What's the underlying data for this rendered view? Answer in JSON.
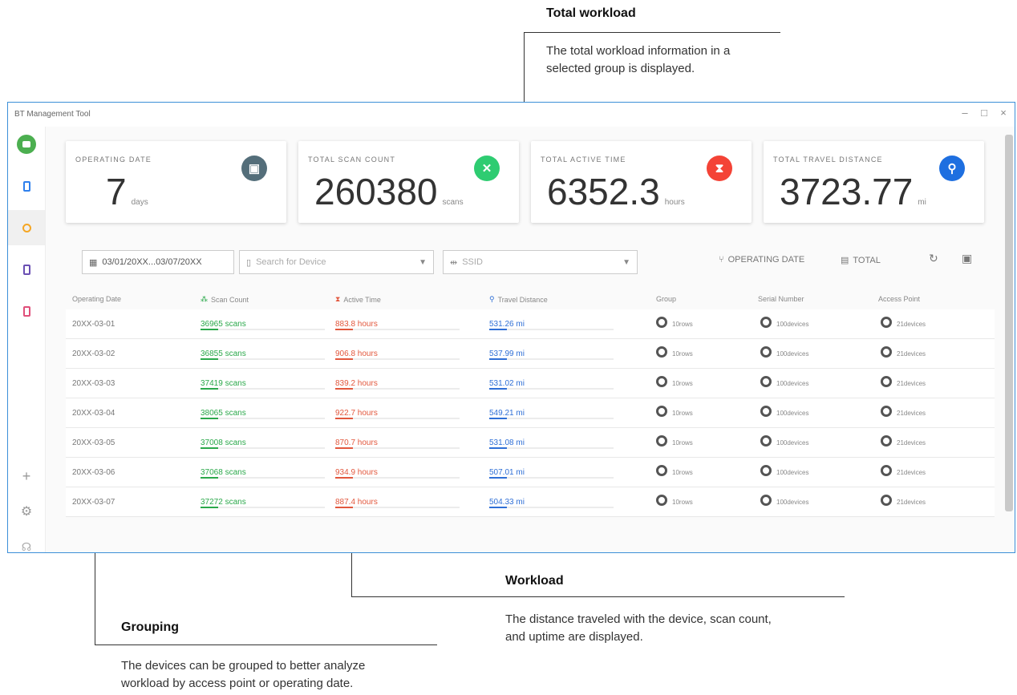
{
  "annotations": {
    "total_workload": {
      "title": "Total workload",
      "text_line1": "The total workload information in a",
      "text_line2": "selected group is displayed."
    },
    "workload": {
      "title": "Workload",
      "text_line1": "The distance traveled with the device, scan count,",
      "text_line2": "and uptime are displayed."
    },
    "grouping": {
      "title": "Grouping",
      "text_line1": "The devices can be grouped to better analyze",
      "text_line2": "workload by access point or operating date."
    }
  },
  "window": {
    "title": "BT Management Tool",
    "min": "–",
    "max": "□",
    "close": "×"
  },
  "cards": [
    {
      "label": "OPERATING DATE",
      "value": "7",
      "unit": "days",
      "icon": "calendar-icon",
      "color": "#546e7a"
    },
    {
      "label": "TOTAL SCAN COUNT",
      "value": "260380",
      "unit": "scans",
      "icon": "scan-icon",
      "color": "#2ecc71"
    },
    {
      "label": "TOTAL ACTIVE TIME",
      "value": "6352.3",
      "unit": "hours",
      "icon": "hourglass-icon",
      "color": "#f44336"
    },
    {
      "label": "TOTAL TRAVEL DISTANCE",
      "value": "3723.77",
      "unit": "mi",
      "icon": "walk-icon",
      "color": "#1e6fe0"
    }
  ],
  "filters": {
    "date_range": "03/01/20XX...03/07/20XX",
    "device_search_placeholder": "Search for Device",
    "ssid_placeholder": "SSID",
    "operating_date_button": "OPERATING DATE",
    "total_button": "TOTAL"
  },
  "table": {
    "headers": [
      "Operating Date",
      "Scan Count",
      "Active Time",
      "Travel Distance",
      "Group",
      "Serial Number",
      "Access Point"
    ],
    "rows": [
      {
        "date": "20XX-03-01",
        "scan": "36965 scans",
        "time": "883.8 hours",
        "distance": "531.26 mi",
        "group": "10rows",
        "serial": "100devices",
        "ap": "21devices"
      },
      {
        "date": "20XX-03-02",
        "scan": "36855 scans",
        "time": "906.8 hours",
        "distance": "537.99 mi",
        "group": "10rows",
        "serial": "100devices",
        "ap": "21devices"
      },
      {
        "date": "20XX-03-03",
        "scan": "37419 scans",
        "time": "839.2 hours",
        "distance": "531.02 mi",
        "group": "10rows",
        "serial": "100devices",
        "ap": "21devices"
      },
      {
        "date": "20XX-03-04",
        "scan": "38065 scans",
        "time": "922.7 hours",
        "distance": "549.21 mi",
        "group": "10rows",
        "serial": "100devices",
        "ap": "21devices"
      },
      {
        "date": "20XX-03-05",
        "scan": "37008 scans",
        "time": "870.7 hours",
        "distance": "531.08 mi",
        "group": "10rows",
        "serial": "100devices",
        "ap": "21devices"
      },
      {
        "date": "20XX-03-06",
        "scan": "37068 scans",
        "time": "934.9 hours",
        "distance": "507.01 mi",
        "group": "10rows",
        "serial": "100devices",
        "ap": "21devices"
      },
      {
        "date": "20XX-03-07",
        "scan": "37272 scans",
        "time": "887.4 hours",
        "distance": "504.33 mi",
        "group": "10rows",
        "serial": "100devices",
        "ap": "21devices"
      }
    ],
    "colors": {
      "scan": "#2aa84a",
      "time": "#e2573d",
      "distance": "#2f6fd6"
    }
  }
}
